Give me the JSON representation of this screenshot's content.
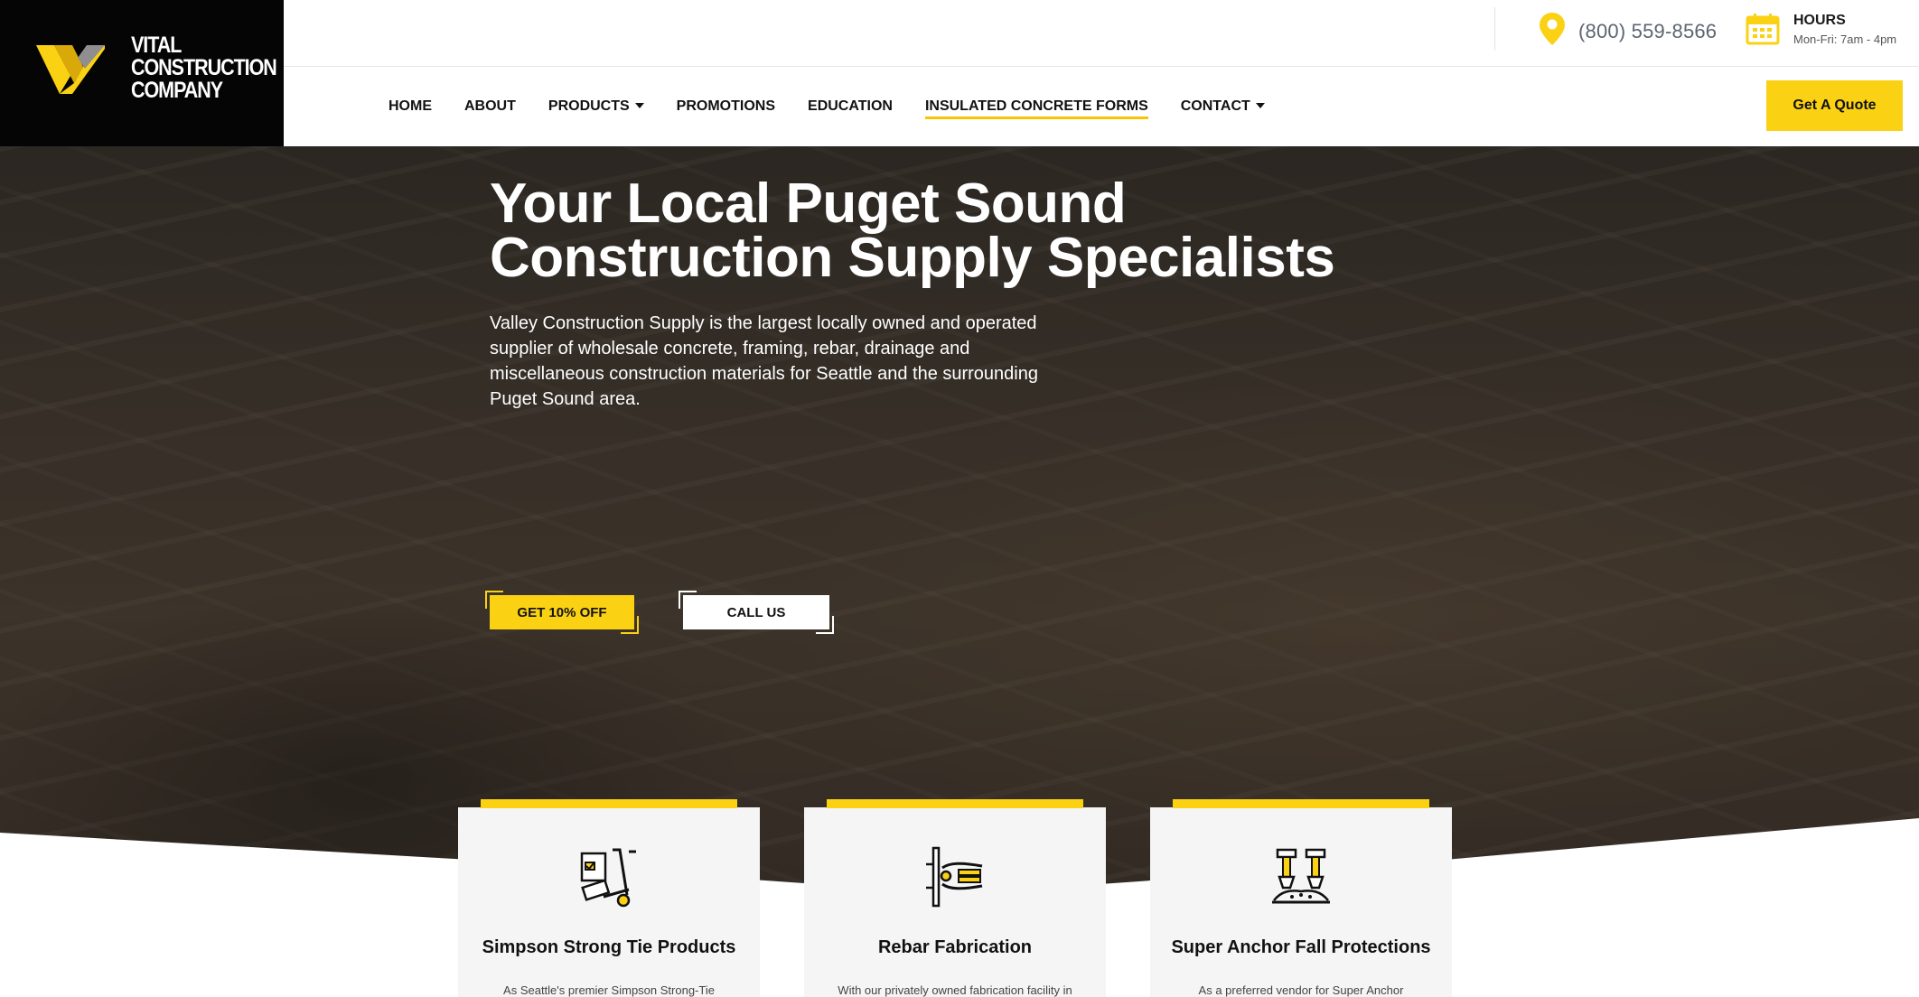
{
  "brand": {
    "logo_lines": [
      "VITAL",
      "CONSTRUCTION",
      "COMPANY"
    ],
    "accent_color": "#fbd114",
    "dark_color": "#050505"
  },
  "topbar": {
    "phone": "(800) 559-8566",
    "phone_icon": "map-pin-icon",
    "hours_title": "HOURS",
    "hours_value": "Mon-Fri: 7am - 4pm",
    "hours_icon": "calendar-icon"
  },
  "nav": {
    "items": [
      {
        "label": "HOME",
        "dropdown": false
      },
      {
        "label": "ABOUT",
        "dropdown": false
      },
      {
        "label": "PRODUCTS",
        "dropdown": true
      },
      {
        "label": "PROMOTIONS",
        "dropdown": false
      },
      {
        "label": "EDUCATION",
        "dropdown": false
      },
      {
        "label": "INSULATED CONCRETE FORMS",
        "dropdown": false,
        "active": true
      },
      {
        "label": "CONTACT",
        "dropdown": true
      }
    ],
    "quote_label": "Get A Quote"
  },
  "hero": {
    "title_line1": "Your Local Puget Sound",
    "title_line2": "Construction Supply Specialists",
    "text": "Valley Construction Supply is the largest locally owned and operated supplier of wholesale concrete, framing, rebar, drainage and miscellaneous construction materials for Seattle and the surrounding Puget Sound area.",
    "primary_cta": "GET 10% OFF",
    "secondary_cta": "CALL US"
  },
  "cards": [
    {
      "icon": "hand-truck-icon",
      "title": "Simpson Strong Tie Products",
      "text": "As Seattle's premier Simpson Strong-Tie"
    },
    {
      "icon": "rebar-cutter-icon",
      "title": "Rebar Fabrication",
      "text": "With our privately owned fabrication facility in"
    },
    {
      "icon": "fall-anchor-icon",
      "title": "Super Anchor Fall Protections",
      "text": "As a preferred vendor for Super Anchor"
    }
  ]
}
